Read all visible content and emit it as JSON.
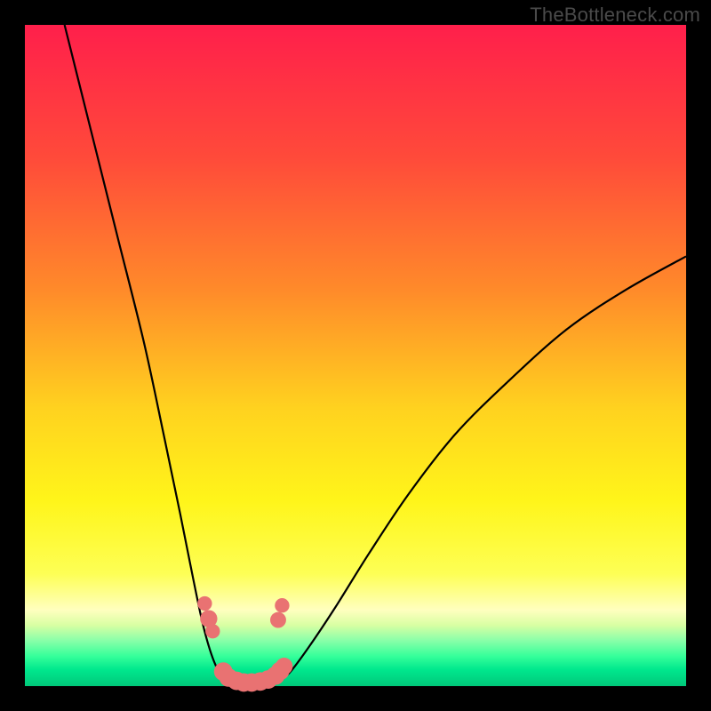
{
  "watermark": "TheBottleneck.com",
  "chart_data": {
    "type": "line",
    "title": "",
    "xlabel": "",
    "ylabel": "",
    "xlim": [
      0,
      100
    ],
    "ylim": [
      0,
      100
    ],
    "gradient_stops": [
      {
        "offset": 0.0,
        "color": "#ff1f4b"
      },
      {
        "offset": 0.2,
        "color": "#ff4a3a"
      },
      {
        "offset": 0.4,
        "color": "#ff8a2a"
      },
      {
        "offset": 0.58,
        "color": "#ffd21f"
      },
      {
        "offset": 0.72,
        "color": "#fff51a"
      },
      {
        "offset": 0.83,
        "color": "#fdff55"
      },
      {
        "offset": 0.885,
        "color": "#ffffbf"
      },
      {
        "offset": 0.908,
        "color": "#d8ffa3"
      },
      {
        "offset": 0.93,
        "color": "#8dffa9"
      },
      {
        "offset": 0.955,
        "color": "#35ff9a"
      },
      {
        "offset": 0.975,
        "color": "#00e88d"
      },
      {
        "offset": 1.0,
        "color": "#00c87a"
      }
    ],
    "series": [
      {
        "name": "left-curve",
        "points": [
          {
            "x": 6,
            "y": 100
          },
          {
            "x": 10,
            "y": 84
          },
          {
            "x": 14,
            "y": 68
          },
          {
            "x": 18,
            "y": 52
          },
          {
            "x": 21,
            "y": 38
          },
          {
            "x": 23.5,
            "y": 26
          },
          {
            "x": 25.5,
            "y": 16
          },
          {
            "x": 27,
            "y": 9
          },
          {
            "x": 28.5,
            "y": 4
          },
          {
            "x": 30,
            "y": 1.2
          },
          {
            "x": 32,
            "y": 0.3
          }
        ]
      },
      {
        "name": "valley-floor",
        "points": [
          {
            "x": 32,
            "y": 0.3
          },
          {
            "x": 34,
            "y": 0.15
          },
          {
            "x": 36,
            "y": 0.2
          },
          {
            "x": 38,
            "y": 0.6
          }
        ]
      },
      {
        "name": "right-curve",
        "points": [
          {
            "x": 38,
            "y": 0.6
          },
          {
            "x": 40,
            "y": 2
          },
          {
            "x": 43,
            "y": 6
          },
          {
            "x": 47,
            "y": 12
          },
          {
            "x": 52,
            "y": 20
          },
          {
            "x": 58,
            "y": 29
          },
          {
            "x": 65,
            "y": 38
          },
          {
            "x": 73,
            "y": 46
          },
          {
            "x": 82,
            "y": 54
          },
          {
            "x": 91,
            "y": 60
          },
          {
            "x": 100,
            "y": 65
          }
        ]
      }
    ],
    "markers": [
      {
        "x": 27.2,
        "y": 12.5,
        "r": 1.1
      },
      {
        "x": 27.8,
        "y": 10.2,
        "r": 1.3
      },
      {
        "x": 28.4,
        "y": 8.3,
        "r": 1.1
      },
      {
        "x": 30.0,
        "y": 2.2,
        "r": 1.4
      },
      {
        "x": 30.8,
        "y": 1.3,
        "r": 1.4
      },
      {
        "x": 32.0,
        "y": 0.8,
        "r": 1.4
      },
      {
        "x": 33.1,
        "y": 0.55,
        "r": 1.4
      },
      {
        "x": 34.3,
        "y": 0.55,
        "r": 1.4
      },
      {
        "x": 35.6,
        "y": 0.7,
        "r": 1.4
      },
      {
        "x": 36.8,
        "y": 1.0,
        "r": 1.4
      },
      {
        "x": 37.9,
        "y": 1.6,
        "r": 1.4
      },
      {
        "x": 38.6,
        "y": 2.3,
        "r": 1.4
      },
      {
        "x": 39.2,
        "y": 3.0,
        "r": 1.3
      },
      {
        "x": 38.3,
        "y": 10.0,
        "r": 1.2
      },
      {
        "x": 38.9,
        "y": 12.2,
        "r": 1.1
      }
    ],
    "marker_color": "#e97272",
    "curve_color": "#000000",
    "curve_width": 2.2
  }
}
